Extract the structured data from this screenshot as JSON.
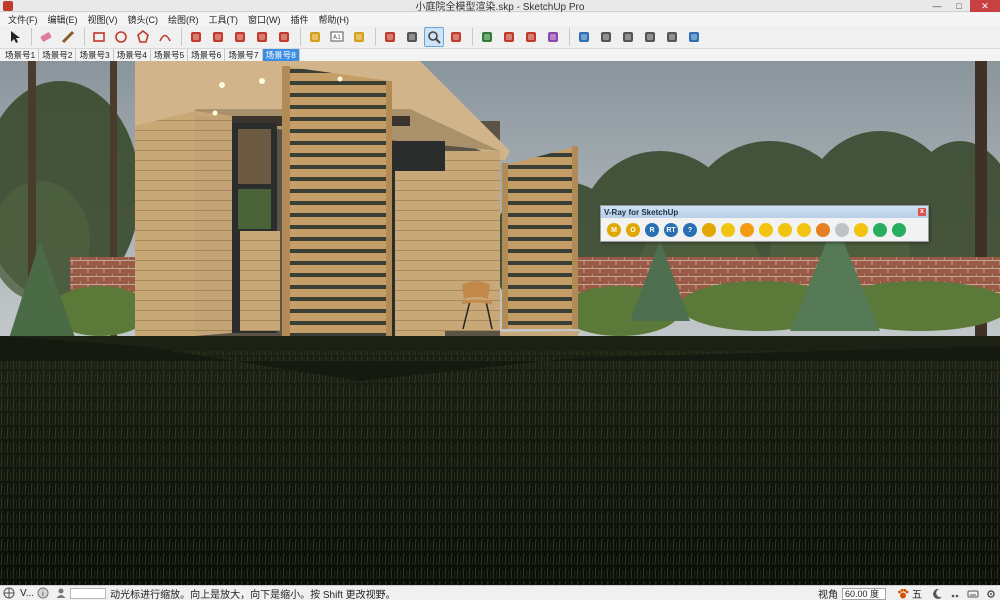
{
  "window": {
    "title": "小庭院全模型渲染.skp - SketchUp Pro",
    "minimize": "—",
    "maximize": "□",
    "close": "✕"
  },
  "menu": [
    "文件(F)",
    "编辑(E)",
    "视图(V)",
    "镜头(C)",
    "绘图(R)",
    "工具(T)",
    "窗口(W)",
    "插件",
    "帮助(H)"
  ],
  "toolbar": {
    "tools": [
      {
        "name": "select-tool-icon",
        "color": "#222222"
      },
      {
        "name": "eraser-tool-icon",
        "color": "#e07aa3"
      },
      {
        "name": "pencil-tool-icon",
        "color": "#8b5a2b"
      },
      {
        "name": "rectangle-tool-icon",
        "color": "#c0392b"
      },
      {
        "name": "circle-tool-icon",
        "color": "#c0392b"
      },
      {
        "name": "polygon-tool-icon",
        "color": "#c0392b"
      },
      {
        "name": "arc-tool-icon",
        "color": "#c0392b"
      },
      {
        "name": "push-pull-tool-icon",
        "color": "#c0392b"
      },
      {
        "name": "follow-me-tool-icon",
        "color": "#c0392b"
      },
      {
        "name": "move-tool-icon",
        "color": "#c0392b"
      },
      {
        "name": "rotate-tool-icon",
        "color": "#c0392b"
      },
      {
        "name": "scale-tool-icon",
        "color": "#c0392b"
      },
      {
        "name": "tape-measure-tool-icon",
        "color": "#d4a017"
      },
      {
        "name": "text-tool-icon",
        "color": "#555555"
      },
      {
        "name": "paint-bucket-tool-icon",
        "color": "#d4a017"
      },
      {
        "name": "orbit-tool-icon",
        "color": "#c0392b"
      },
      {
        "name": "pan-tool-icon",
        "color": "#555555"
      },
      {
        "name": "zoom-tool-icon",
        "color": "#444444"
      },
      {
        "name": "zoom-extents-tool-icon",
        "color": "#c0392b"
      },
      {
        "name": "warehouse-icon",
        "color": "#2e7d32"
      },
      {
        "name": "share-model-icon",
        "color": "#c0392b"
      },
      {
        "name": "components-icon",
        "color": "#c0392b"
      },
      {
        "name": "extension-warehouse-icon",
        "color": "#8e44ad"
      },
      {
        "name": "xray-style-icon",
        "color": "#2c6fb5"
      },
      {
        "name": "wireframe-style-icon",
        "color": "#555555"
      },
      {
        "name": "hidden-line-style-icon",
        "color": "#555555"
      },
      {
        "name": "shaded-style-icon",
        "color": "#555555"
      },
      {
        "name": "shaded-textures-style-icon",
        "color": "#555555"
      },
      {
        "name": "monochrome-style-icon",
        "color": "#2c6fb5"
      }
    ],
    "active_index": 17
  },
  "scenes": [
    "场景号1",
    "场景号2",
    "场景号3",
    "场景号4",
    "场景号5",
    "场景号6",
    "场景号7",
    "场景号8"
  ],
  "active_scene": 7,
  "vray": {
    "title": "V-Ray for SketchUp",
    "close": "x",
    "tools": [
      {
        "name": "vray-material-editor-icon",
        "letter": "M",
        "color": "#e0a800"
      },
      {
        "name": "vray-options-icon",
        "letter": "O",
        "color": "#e0a800"
      },
      {
        "name": "vray-render-icon",
        "letter": "R",
        "color": "#2a6fb3"
      },
      {
        "name": "vray-rt-render-icon",
        "letter": "RT",
        "color": "#2a6fb3"
      },
      {
        "name": "vray-help-icon",
        "letter": "?",
        "color": "#2a6fb3"
      },
      {
        "name": "vray-frame-buffer-icon",
        "letter": "",
        "color": "#e0a800"
      },
      {
        "name": "vray-omni-light-icon",
        "letter": "",
        "color": "#f1c40f"
      },
      {
        "name": "vray-rect-light-icon",
        "letter": "",
        "color": "#f39c12"
      },
      {
        "name": "vray-spot-light-icon",
        "letter": "",
        "color": "#f1c40f"
      },
      {
        "name": "vray-ies-light-icon",
        "letter": "",
        "color": "#f1c40f"
      },
      {
        "name": "vray-dome-light-icon",
        "letter": "",
        "color": "#f1c40f"
      },
      {
        "name": "vray-mesh-light-icon",
        "letter": "",
        "color": "#e67e22"
      },
      {
        "name": "vray-sphere-icon",
        "letter": "",
        "color": "#bdc3c7"
      },
      {
        "name": "vray-infinite-plane-icon",
        "letter": "",
        "color": "#f1c40f"
      },
      {
        "name": "vray-proxy-icon",
        "letter": "",
        "color": "#27ae60"
      },
      {
        "name": "vray-fur-icon",
        "letter": "",
        "color": "#27ae60"
      }
    ]
  },
  "status": {
    "left_label": "V...",
    "message": "动光标进行缩放。向上是放大，向下是缩小。按 Shift 更改视野。",
    "vcb_label": "视角",
    "vcb_value": "60.00 度",
    "ime": "五"
  }
}
